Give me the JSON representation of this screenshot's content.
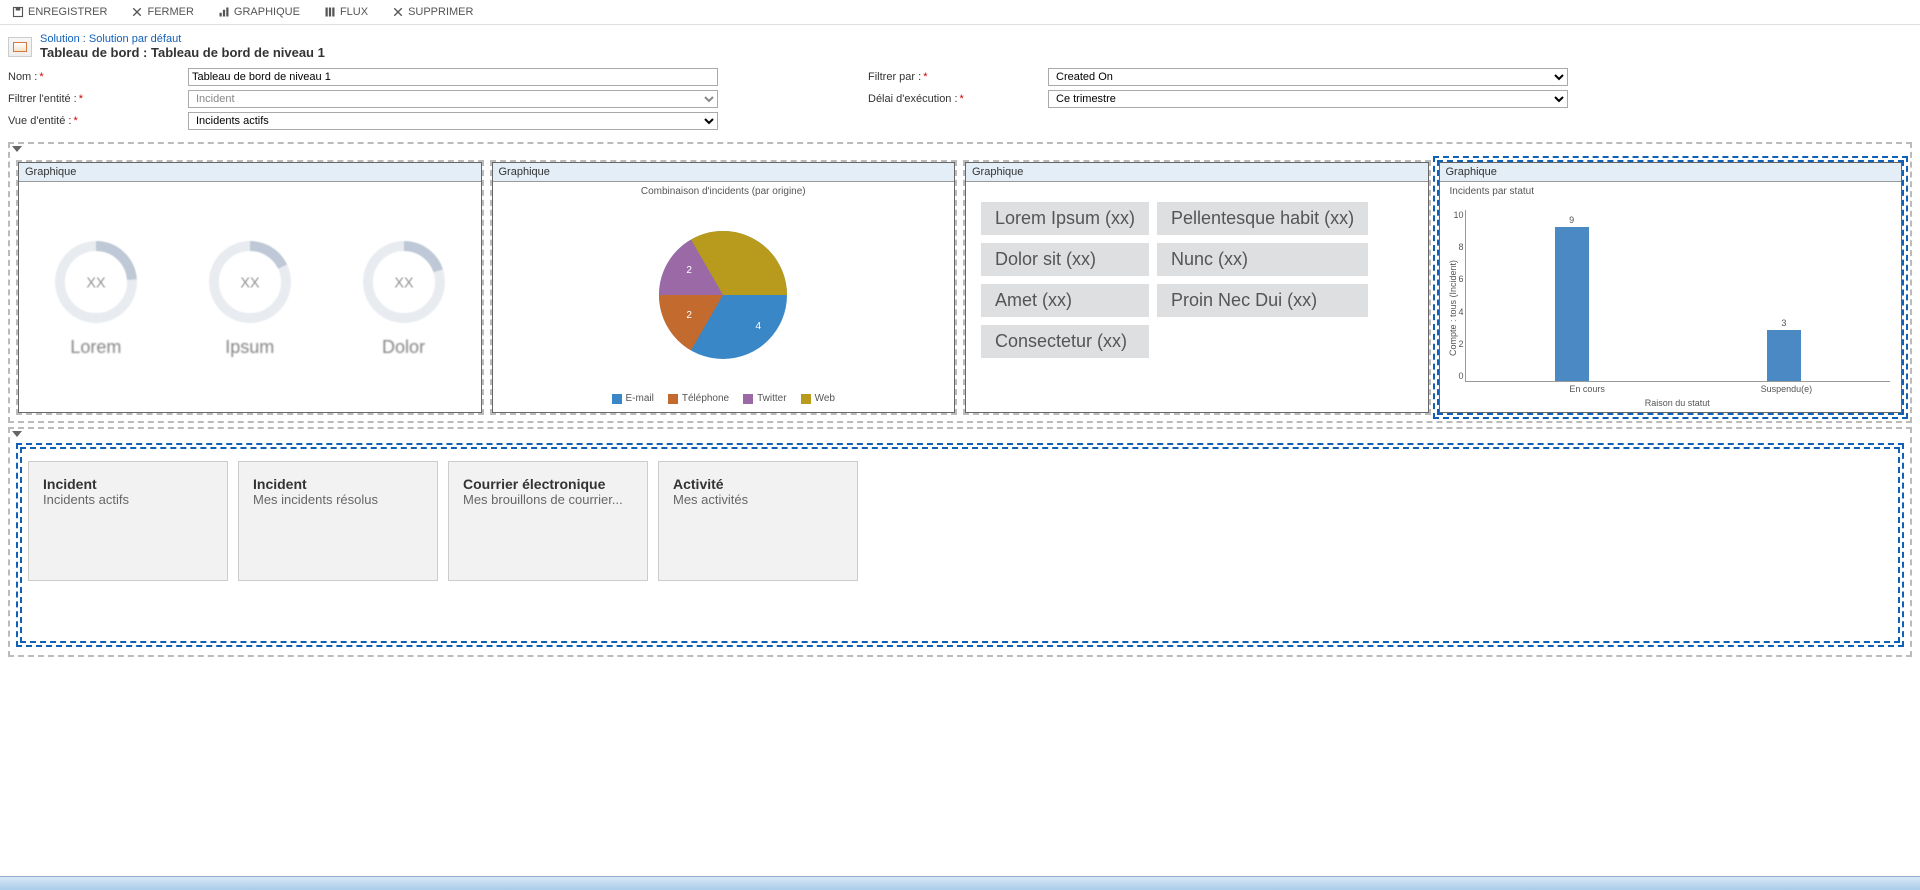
{
  "toolbar": {
    "save": "ENREGISTRER",
    "close": "FERMER",
    "chart": "GRAPHIQUE",
    "flow": "FLUX",
    "delete": "SUPPRIMER"
  },
  "header": {
    "solution_line": "Solution : Solution par défaut",
    "dashboard_line": "Tableau de bord : Tableau de bord de niveau 1"
  },
  "form": {
    "name_label": "Nom :",
    "name_value": "Tableau de bord de niveau 1",
    "filter_entity_label": "Filtrer l'entité :",
    "filter_entity_value": "Incident",
    "entity_view_label": "Vue d'entité :",
    "entity_view_value": "Incidents actifs",
    "filter_by_label": "Filtrer par :",
    "filter_by_value": "Created On",
    "timeframe_label": "Délai d'exécution :",
    "timeframe_value": "Ce trimestre"
  },
  "cards": {
    "header_label": "Graphique",
    "gauges": {
      "value": "XX",
      "labels": [
        "Lorem",
        "Ipsum",
        "Dolor"
      ]
    },
    "pie": {
      "title": "Combinaison d'incidents (par origine)",
      "legend": [
        "E-mail",
        "Téléphone",
        "Twitter",
        "Web"
      ],
      "colors": [
        "#3a87c8",
        "#c36a2e",
        "#9b6aa6",
        "#b89b1d"
      ]
    },
    "tags": [
      "Lorem Ipsum (xx)",
      "Dolor sit (xx)",
      "Amet (xx)",
      "Consectetur  (xx)",
      "Pellentesque habit  (xx)",
      "Nunc (xx)",
      "Proin Nec Dui (xx)"
    ],
    "bar": {
      "title": "Incidents par statut",
      "y_label": "Compte : tous (Incident)",
      "x_title": "Raison du statut"
    }
  },
  "tiles": [
    {
      "title": "Incident",
      "sub": "Incidents actifs"
    },
    {
      "title": "Incident",
      "sub": "Mes incidents résolus"
    },
    {
      "title": "Courrier électronique",
      "sub": "Mes brouillons de courrier..."
    },
    {
      "title": "Activité",
      "sub": "Mes activités"
    }
  ],
  "chart_data": [
    {
      "type": "pie",
      "title": "Combinaison d'incidents (par origine)",
      "categories": [
        "E-mail",
        "Téléphone",
        "Twitter",
        "Web"
      ],
      "values": [
        4,
        2,
        2,
        4
      ]
    },
    {
      "type": "bar",
      "title": "Incidents par statut",
      "categories": [
        "En cours",
        "Suspendu(e)"
      ],
      "values": [
        9,
        3
      ],
      "xlabel": "Raison du statut",
      "ylabel": "Compte : tous (Incident)",
      "ylim": [
        0,
        10
      ]
    }
  ]
}
